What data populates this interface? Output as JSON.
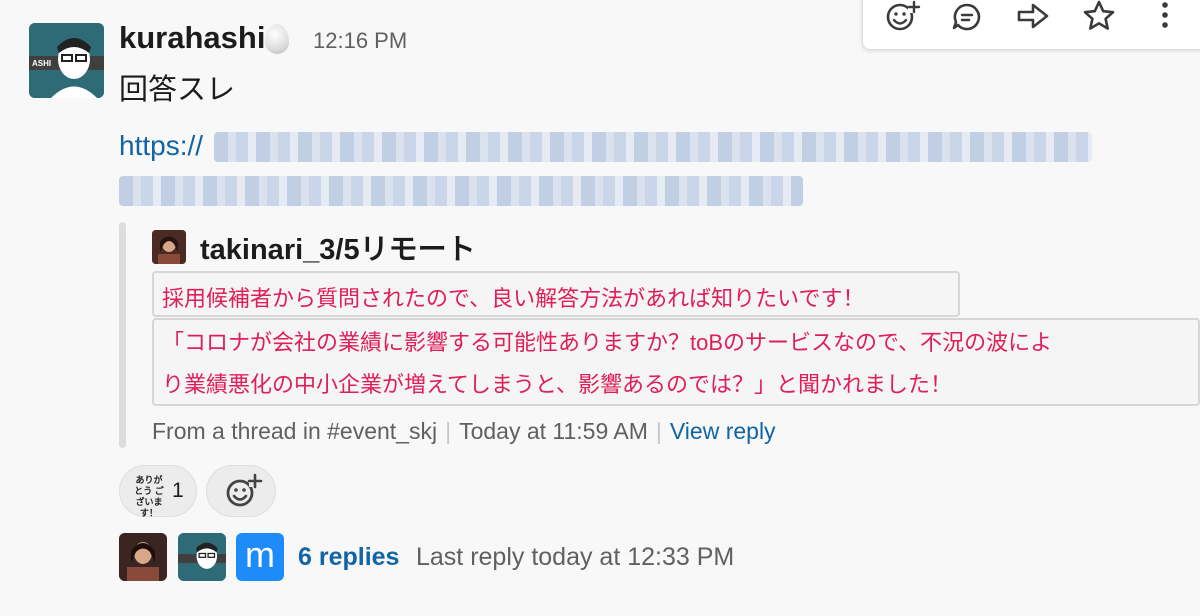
{
  "message": {
    "sender": "kurahashi",
    "time": "12:16 PM",
    "text": "回答スレ",
    "link_prefix": "https://"
  },
  "quote": {
    "author": "takinari_3/5リモート",
    "line1": "採用候補者から質問されたので、良い解答方法があれば知りたいです！",
    "line2a": "「コロナが会社の業績に影響する可能性ありますか？toBのサービスなので、不況の波によ",
    "line2b": "り業績悪化の中小企業が増えてしまうと、影響あるのでは？」と聞かれました！",
    "from": "From a thread in #event_skj",
    "today": "Today at 11:59 AM",
    "view_reply": "View reply"
  },
  "reactions": [
    {
      "emoji_text": "ありがとう ございます！",
      "count": "1"
    }
  ],
  "thread": {
    "third_avatar_letter": "m",
    "replies": "6 replies",
    "last_reply": "Last reply today at 12:33 PM"
  },
  "toolbar": {
    "icons": [
      "add-reaction-icon",
      "reply-in-thread-icon",
      "share-icon",
      "star-icon",
      "more-actions-icon"
    ]
  },
  "colors": {
    "link": "#1264a3",
    "code_text": "#e01e5a",
    "secondary_text": "#616061"
  }
}
